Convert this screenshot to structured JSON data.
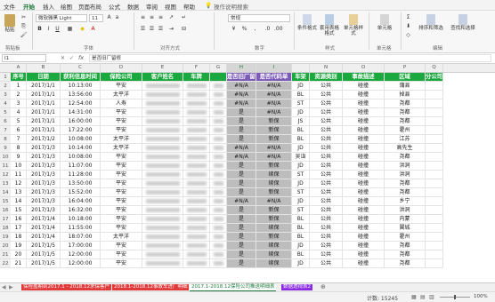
{
  "menu": {
    "tabs": [
      "文件",
      "开始",
      "插入",
      "绘图",
      "页面布局",
      "公式",
      "数据",
      "审阅",
      "视图",
      "帮助"
    ],
    "active": "开始",
    "search_label": "操作说明搜索"
  },
  "ribbon": {
    "paste_label": "粘贴",
    "clipboard_label": "剪贴板",
    "font_name": "微软雅黑 Light",
    "font_size": "11",
    "font_group_label": "字体",
    "align_group_label": "对齐方式",
    "number_format": "常规",
    "number_group_label": "数字",
    "cond_format_label": "条件格式",
    "table_format_label": "套用表格格式",
    "cell_style_label": "单元格样式",
    "style_group_label": "样式",
    "cells_label": "单元格",
    "cells_group_label": "单元格",
    "sort_label": "排序和筛选",
    "find_label": "查找和选择",
    "edit_group_label": "编辑"
  },
  "formula": {
    "name_box": "I1",
    "fx": "fx",
    "content": "是否旧厂留修"
  },
  "col_letters": [
    "A",
    "B",
    "C",
    "D",
    "E",
    "F",
    "G",
    "H",
    "I",
    "",
    "N",
    "O",
    "P",
    "Q"
  ],
  "headers": [
    "序号",
    "日期",
    "获利信息时间",
    "保险公司",
    "客户姓名",
    "车牌",
    "",
    "是否旧厂留修",
    "是否代码单",
    "车架",
    "资源类别",
    "事故描述",
    "区域",
    "分公司"
  ],
  "rows": [
    [
      "1",
      "2017/1/1",
      "10:13:00",
      "平安",
      "",
      "",
      "",
      "#N/A",
      "#N/A",
      "JD",
      "公共",
      "碰撞",
      "蒲县",
      ""
    ],
    [
      "2",
      "2017/1/1",
      "13:56:00",
      "太平洋",
      "",
      "",
      "",
      "#N/A",
      "#N/A",
      "BL",
      "公共",
      "碰撞",
      "掉县",
      ""
    ],
    [
      "3",
      "2017/1/1",
      "12:54:00",
      "人寿",
      "",
      "",
      "",
      "#N/A",
      "#N/A",
      "ST",
      "公共",
      "碰撞",
      "尧都",
      ""
    ],
    [
      "4",
      "2017/1/1",
      "14:31:00",
      "平安",
      "",
      "",
      "",
      "是",
      "#N/A",
      "JD",
      "公共",
      "碰撞",
      "尧都",
      ""
    ],
    [
      "5",
      "2017/1/1",
      "16:00:00",
      "平安",
      "",
      "",
      "",
      "是",
      "新保",
      "JS",
      "公共",
      "碰撞",
      "尧都",
      ""
    ],
    [
      "6",
      "2017/1/1",
      "17:22:00",
      "平安",
      "",
      "",
      "",
      "是",
      "新保",
      "BL",
      "公共",
      "碰撞",
      "霍州",
      ""
    ],
    [
      "7",
      "2017/1/2",
      "10:08:00",
      "太平洋",
      "",
      "",
      "",
      "是",
      "新保",
      "BL",
      "公共",
      "碰撞",
      "江苏",
      ""
    ],
    [
      "8",
      "2017/1/3",
      "10:14:00",
      "太平洋",
      "",
      "",
      "",
      "#N/A",
      "#N/A",
      "JD",
      "公共",
      "碰撞",
      "高先生",
      ""
    ],
    [
      "9",
      "2017/1/3",
      "10:08:00",
      "平安",
      "",
      "",
      "",
      "#N/A",
      "#N/A",
      "吴诣",
      "公共",
      "碰撞",
      "尧都",
      ""
    ],
    [
      "10",
      "2017/1/3",
      "11:07:00",
      "平安",
      "",
      "",
      "",
      "是",
      "新保",
      "JD",
      "公共",
      "碰撞",
      "洪洞",
      ""
    ],
    [
      "11",
      "2017/1/3",
      "11:28:00",
      "平安",
      "",
      "",
      "",
      "是",
      "续保",
      "ST",
      "公共",
      "碰撞",
      "洪洞",
      ""
    ],
    [
      "12",
      "2017/1/3",
      "13:50:00",
      "平安",
      "",
      "",
      "",
      "是",
      "续保",
      "JD",
      "公共",
      "碰撞",
      "尧都",
      ""
    ],
    [
      "13",
      "2017/1/3",
      "15:52:00",
      "平安",
      "",
      "",
      "",
      "是",
      "新保",
      "ST",
      "公共",
      "碰撞",
      "尧都",
      ""
    ],
    [
      "14",
      "2017/1/3",
      "16:04:00",
      "平安",
      "",
      "",
      "",
      "#N/A",
      "#N/A",
      "JD",
      "公共",
      "碰撞",
      "乡宁",
      ""
    ],
    [
      "15",
      "2017/1/3",
      "16:32:00",
      "平安",
      "",
      "",
      "",
      "是",
      "新保",
      "ST",
      "公共",
      "碰撞",
      "洪洞",
      ""
    ],
    [
      "16",
      "2017/1/4",
      "10:18:00",
      "平安",
      "",
      "",
      "",
      "是",
      "新保",
      "BL",
      "公共",
      "碰撞",
      "内蒙",
      ""
    ],
    [
      "17",
      "2017/1/4",
      "11:55:00",
      "平安",
      "",
      "",
      "",
      "是",
      "续保",
      "BL",
      "公共",
      "碰撞",
      "翼城",
      ""
    ],
    [
      "18",
      "2017/1/4",
      "18:07:00",
      "太平洋",
      "",
      "",
      "",
      "是",
      "新保",
      "BL",
      "公共",
      "碰撞",
      "霍州",
      ""
    ],
    [
      "19",
      "2017/1/5",
      "17:00:00",
      "平安",
      "",
      "",
      "",
      "是",
      "续保",
      "JD",
      "公共",
      "碰撞",
      "尧都",
      ""
    ],
    [
      "20",
      "2017/1/5",
      "12:00:00",
      "平安",
      "",
      "",
      "",
      "是",
      "续保",
      "BL",
      "公共",
      "碰撞",
      "尧都",
      ""
    ],
    [
      "21",
      "2017/1/5",
      "12:00:00",
      "平安",
      "",
      "",
      "",
      "是",
      "续保",
      "JD",
      "公共",
      "碰撞",
      "尧都",
      ""
    ]
  ],
  "sheets": [
    {
      "label": "保险盈期到2017.1 - 2018.12求保客户",
      "color": "#e03a3a"
    },
    {
      "label": "2018.1-2018.12事故车进厂明细",
      "color": "#e03a3a"
    },
    {
      "label": "2017.1-2018.12保险公司推送明细表",
      "color": "#e03a3a"
    },
    {
      "label": "数据透视表2",
      "color": "#8a2be2"
    }
  ],
  "status": {
    "count": "计数: 15245",
    "zoom": "100%"
  },
  "colors": {
    "header_green": "#1ba83f",
    "header_purple": "#7b5ab8",
    "accent": "#1e7a3c"
  }
}
